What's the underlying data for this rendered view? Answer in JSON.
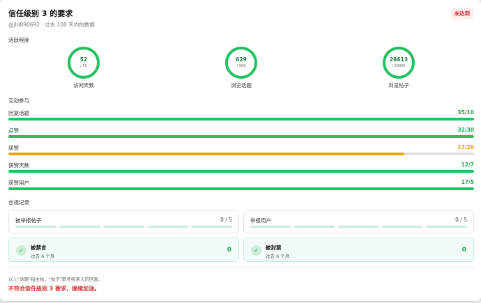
{
  "header": {
    "title": "信任级别 3 的要求",
    "status_badge": "未达到",
    "subtitle": "@jld890692 · 过去 100 天内的数据"
  },
  "activity": {
    "section_label": "活跃程度",
    "rings": [
      {
        "value": "52",
        "goal": "/ 50",
        "label": "访问天数",
        "progress": 1.0
      },
      {
        "value": "629",
        "goal": "/ 500",
        "label": "浏览话题",
        "progress": 1.0
      },
      {
        "value": "28613",
        "goal": "/ 20000",
        "label": "浏览帖子",
        "progress": 1.0
      }
    ]
  },
  "engagement": {
    "section_label": "互动参与",
    "bars": [
      {
        "label": "回复话题",
        "count": "35/10",
        "progress": 1.0,
        "met": true
      },
      {
        "label": "点赞",
        "count": "32/30",
        "progress": 1.0,
        "met": true
      },
      {
        "label": "获赞",
        "count": "17/20",
        "progress": 0.85,
        "met": false
      },
      {
        "label": "获赞天数",
        "count": "12/7",
        "progress": 1.0,
        "met": true
      },
      {
        "label": "获赞用户",
        "count": "17/5",
        "progress": 1.0,
        "met": true
      }
    ]
  },
  "compliance": {
    "section_label": "合规记录",
    "flagged_posts": {
      "label": "被举报帖子",
      "count": "0 / 5"
    },
    "flagged_users": {
      "label": "举报用户",
      "count": "0 / 5"
    },
    "silenced": {
      "title": "被禁言",
      "sub": "过去 6 个月",
      "count": "0"
    },
    "suspended": {
      "title": "被封禁",
      "sub": "过去 6 个月",
      "count": "0"
    }
  },
  "footer": {
    "note": "以上\"话题\"指主帖，\"帖子\"即传统意义的回复。",
    "result": "不符合信任级别 3 要求，继续加油。"
  },
  "colors": {
    "accent": "#23c162",
    "warn": "#e8a50f",
    "danger": "#d32f2f"
  },
  "icons": {
    "check": "check-icon"
  }
}
